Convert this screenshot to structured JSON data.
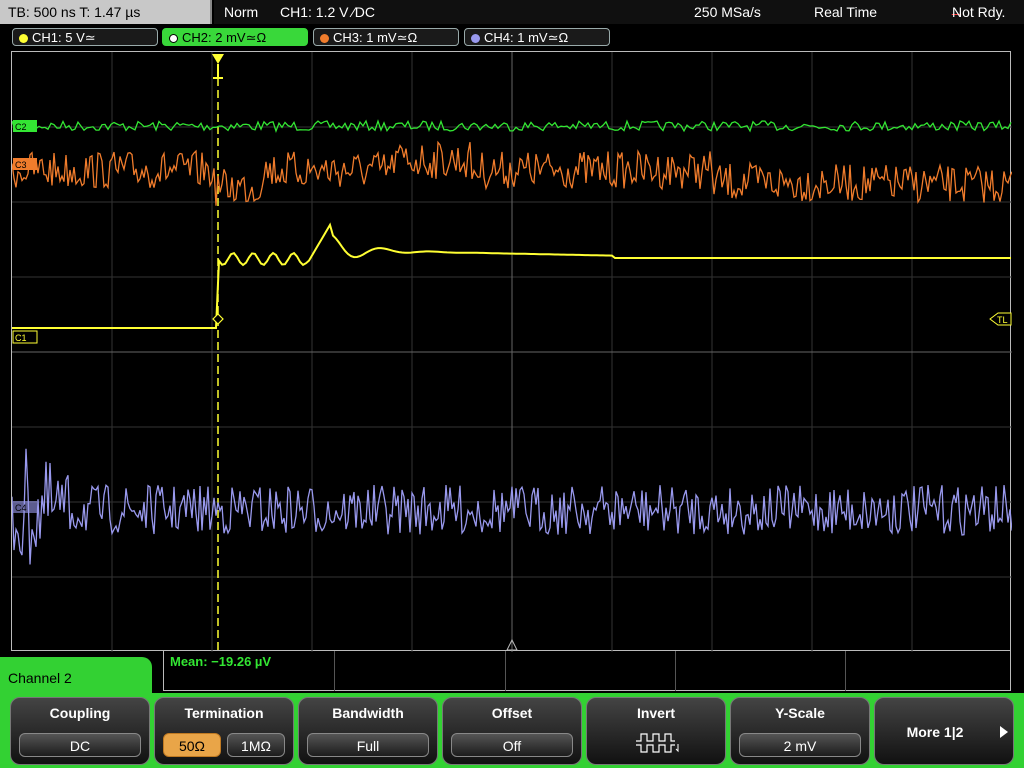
{
  "status_bar": {
    "timebase": "TB: 500 ns   T: 1.47 µs",
    "trigger_mode": "Norm",
    "trigger_info": "CH1: 1.2 V ∕DC",
    "sample_rate": "250 MSa/s",
    "acq_mode": "Real Time",
    "ready_state": "Not Rdy."
  },
  "channel_tabs": [
    {
      "label": "CH1: 5 V≃",
      "color": "#ffff33"
    },
    {
      "label": "CH2: 2 mV≃Ω",
      "color": "#33e633"
    },
    {
      "label": "CH3: 1 mV≃Ω",
      "color": "#f07c2c"
    },
    {
      "label": "CH4: 1 mV≃Ω",
      "color": "#9999ee"
    }
  ],
  "trace_markers": {
    "ch1": "C1",
    "ch2": "C2",
    "ch3": "C3",
    "ch4": "C4",
    "trigger_level": "TL"
  },
  "measurement": {
    "label": "Mean: −19.26 µV"
  },
  "channel_panel": {
    "title": "Channel 2"
  },
  "softkeys": {
    "coupling": {
      "label": "Coupling",
      "value": "DC"
    },
    "termination": {
      "label": "Termination",
      "opt1": "50Ω",
      "opt2": "1MΩ"
    },
    "bandwidth": {
      "label": "Bandwidth",
      "value": "Full"
    },
    "offset": {
      "label": "Offset",
      "value": "Off"
    },
    "invert": {
      "label": "Invert"
    },
    "yscale": {
      "label": "Y-Scale",
      "value": "2 mV"
    },
    "more": {
      "label": "More 1|2"
    }
  },
  "colors": {
    "ch1": "#ffff33",
    "ch2": "#33e633",
    "ch3": "#f07c2c",
    "ch4": "#9999ee",
    "panel_green": "#33d133"
  }
}
